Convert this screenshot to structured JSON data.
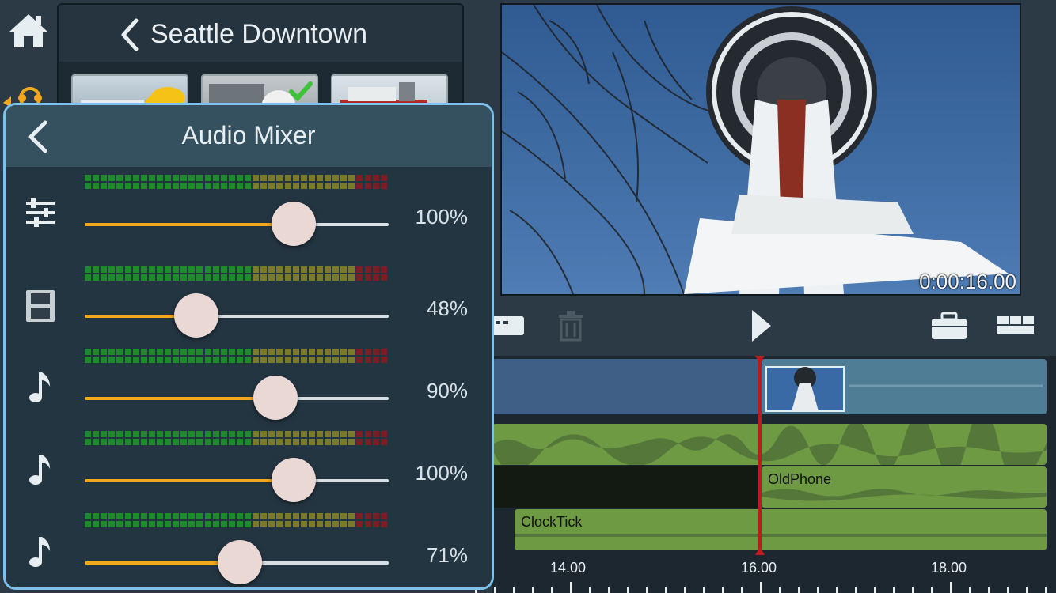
{
  "library": {
    "title": "Seattle Downtown"
  },
  "mixer": {
    "title": "Audio Mixer",
    "channels": [
      {
        "icon": "mixer-sliders-icon",
        "level": 100,
        "label": "100%"
      },
      {
        "icon": "film-strip-icon",
        "level": 48,
        "label": "48%"
      },
      {
        "icon": "music-note-icon",
        "level": 90,
        "label": "90%"
      },
      {
        "icon": "music-note-icon",
        "level": 100,
        "label": "100%"
      },
      {
        "icon": "music-note-icon",
        "level": 71,
        "label": "71%"
      }
    ]
  },
  "preview": {
    "timecode": "0:00:16.00"
  },
  "timeline": {
    "clips": {
      "audio2": "OldPhone",
      "audio3": "ClockTick"
    },
    "ruler": {
      "labels": [
        "14.00",
        "16.00",
        "18.00"
      ]
    }
  },
  "colors": {
    "accent": "#f2a81d",
    "panel_border": "#7dc1ea",
    "playhead": "#c0181c",
    "audio_clip": "#6f9a44"
  }
}
